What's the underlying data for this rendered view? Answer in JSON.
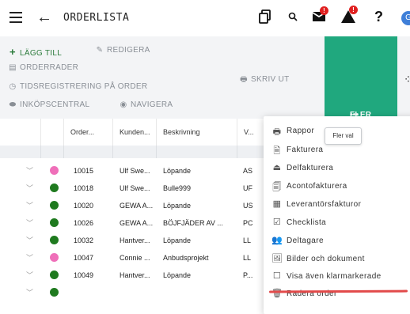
{
  "header": {
    "title": "ORDERLISTA",
    "back_icon": "←",
    "avatar_initial": "G",
    "badge_mail": "!",
    "badge_alert": "!",
    "help": "?"
  },
  "toolbar": {
    "add_label": "LÄGG TILL",
    "edit_label": "REDIGERA",
    "orderrows_label": "ORDERRADER",
    "timereg_label": "TIDSREGISTRERING PÅ ORDER",
    "purchase_label": "INKÖPSCENTRAL",
    "navigate_label": "NAVIGERA",
    "print_label": "SKRIV UT",
    "more_label": "FLER VAL"
  },
  "table": {
    "columns": [
      "Order...",
      "Kunden...",
      "Beskrivning",
      "V..."
    ],
    "rows": [
      {
        "order": "10015",
        "customer": "Ulf Swe...",
        "desc": "Löpande",
        "v": "AS",
        "status": "pink"
      },
      {
        "order": "10018",
        "customer": "Ulf Swe...",
        "desc": "Bulle999",
        "v": "UF",
        "status": "green"
      },
      {
        "order": "10020",
        "customer": "GEWA A...",
        "desc": "Löpande",
        "v": "US",
        "status": "green"
      },
      {
        "order": "10026",
        "customer": "GEWA A...",
        "desc": "BÖJFJÄDER AV ...",
        "v": "PC",
        "status": "green"
      },
      {
        "order": "10032",
        "customer": "Hantver...",
        "desc": "Löpande",
        "v": "LL",
        "status": "green"
      },
      {
        "order": "10047",
        "customer": "Connie ...",
        "desc": "Anbudsprojekt",
        "v": "LL",
        "status": "pink"
      },
      {
        "order": "10049",
        "customer": "Hantver...",
        "desc": "Löpande",
        "v": "P...",
        "status": "green"
      }
    ]
  },
  "tooltip": "Fler val",
  "menu": {
    "items": [
      {
        "label": "Rappor",
        "icon": "🖶",
        "icon_name": "print-icon"
      },
      {
        "label": "Fakturera",
        "icon": "🗎",
        "icon_name": "invoice-icon"
      },
      {
        "label": "Delfakturera",
        "icon": "⏏",
        "icon_name": "partial-invoice-icon"
      },
      {
        "label": "Acontofakturera",
        "icon": "🗐",
        "icon_name": "aconto-invoice-icon"
      },
      {
        "label": "Leverantörsfakturor",
        "icon": "▦",
        "icon_name": "supplier-invoices-icon"
      },
      {
        "label": "Checklista",
        "icon": "☑",
        "icon_name": "checklist-icon"
      },
      {
        "label": "Deltagare",
        "icon": "👥",
        "icon_name": "participants-icon"
      },
      {
        "label": "Bilder och dokument",
        "icon": "🖼",
        "icon_name": "images-documents-icon"
      },
      {
        "label": "Visa även klarmarkerade",
        "icon": "☐",
        "icon_name": "checkbox-icon"
      },
      {
        "label": "Radera order",
        "icon": "🗑",
        "icon_name": "delete-icon"
      }
    ]
  },
  "colors": {
    "accent_green": "#20a87e",
    "status_green": "#1f7a1f",
    "status_pink": "#ef6fb9",
    "badge_red": "#e02020",
    "annotation_red": "#e24a4a"
  }
}
